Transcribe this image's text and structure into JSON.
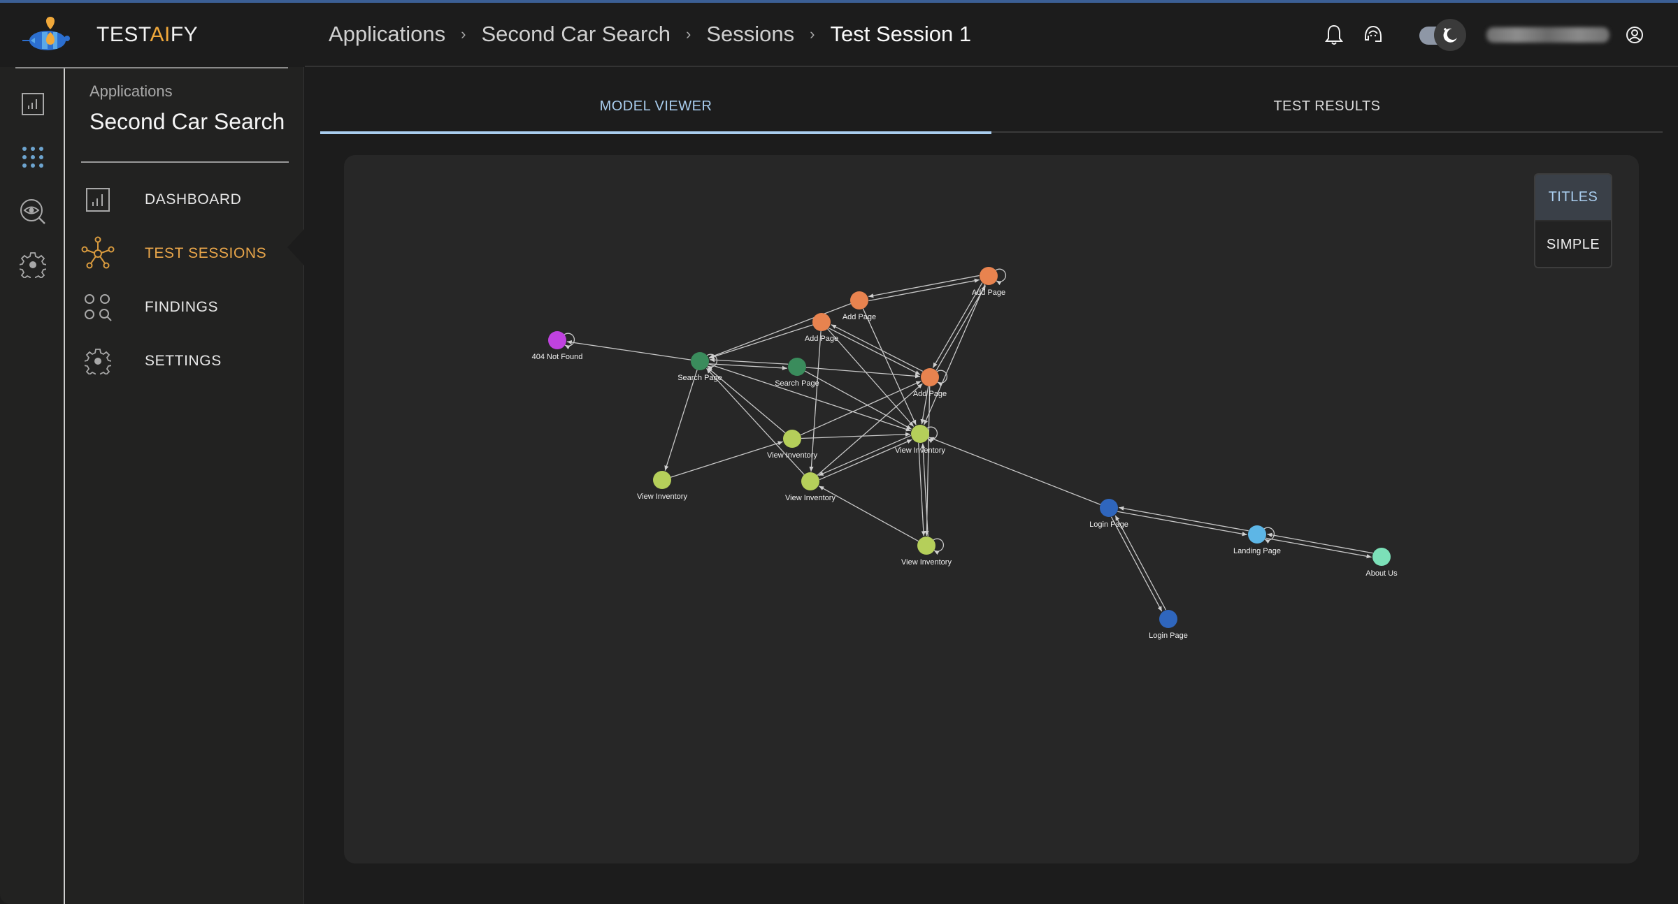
{
  "brand": {
    "name_prefix": "TEST",
    "name_accent": "AI",
    "name_suffix": "FY",
    "accent_color": "#f0a83a"
  },
  "breadcrumb": [
    {
      "label": "Applications"
    },
    {
      "label": "Second Car Search"
    },
    {
      "label": "Sessions"
    },
    {
      "label": "Test Session 1"
    }
  ],
  "breadcrumb_separator": "›",
  "header": {
    "icons": [
      "bell-icon",
      "support-headset-icon",
      "theme-toggle-moon-icon",
      "user-profile-icon"
    ],
    "theme": "dark",
    "user_name_blurred": true
  },
  "rail": {
    "items": [
      "dashboard-icon",
      "apps-grid-icon",
      "insights-eye-icon",
      "settings-gear-icon"
    ],
    "active_index": 1
  },
  "sidebar": {
    "section_label": "Applications",
    "app_title": "Second Car Search",
    "items": [
      {
        "label": "DASHBOARD",
        "icon": "dashboard-icon",
        "active": false
      },
      {
        "label": "TEST SESSIONS",
        "icon": "network-nodes-icon",
        "active": true
      },
      {
        "label": "FINDINGS",
        "icon": "findings-icon",
        "active": false
      },
      {
        "label": "SETTINGS",
        "icon": "gear-icon",
        "active": false
      }
    ]
  },
  "tabs": [
    {
      "label": "MODEL VIEWER",
      "active": true
    },
    {
      "label": "TEST RESULTS",
      "active": false
    }
  ],
  "view_modes": [
    {
      "label": "TITLES",
      "active": true
    },
    {
      "label": "SIMPLE",
      "active": false
    }
  ],
  "colors": {
    "accent": "#a9cdee",
    "active_nav": "#e9a64a",
    "node_404": "#c042e0",
    "node_search": "#3a8c5c",
    "node_add": "#e8834f",
    "node_view": "#b5cf5a",
    "node_login": "#2f66bd",
    "node_landing": "#5db6e6",
    "node_about": "#7ce0b8"
  },
  "graph": {
    "nodes": [
      {
        "id": "n404",
        "label": "404 Not Found",
        "type": "node_404",
        "self_loop": true
      },
      {
        "id": "sp1",
        "label": "Search Page",
        "type": "node_search",
        "self_loop": true
      },
      {
        "id": "sp2",
        "label": "Search Page",
        "type": "node_search",
        "self_loop": false
      },
      {
        "id": "ap1",
        "label": "Add Page",
        "type": "node_add",
        "self_loop": false
      },
      {
        "id": "ap2",
        "label": "Add Page",
        "type": "node_add",
        "self_loop": false
      },
      {
        "id": "ap3",
        "label": "Add Page",
        "type": "node_add",
        "self_loop": true
      },
      {
        "id": "ap4",
        "label": "Add Page",
        "type": "node_add",
        "self_loop": true
      },
      {
        "id": "vi1",
        "label": "View Inventory",
        "type": "node_view",
        "self_loop": false
      },
      {
        "id": "vi2",
        "label": "View Inventory",
        "type": "node_view",
        "self_loop": true
      },
      {
        "id": "vi3",
        "label": "View Inventory",
        "type": "node_view",
        "self_loop": false
      },
      {
        "id": "vi4",
        "label": "View Inventory",
        "type": "node_view",
        "self_loop": false
      },
      {
        "id": "vi5",
        "label": "View Inventory",
        "type": "node_view",
        "self_loop": true
      },
      {
        "id": "lp1",
        "label": "Login Page",
        "type": "node_login",
        "self_loop": false
      },
      {
        "id": "lp2",
        "label": "Login Page",
        "type": "node_login",
        "self_loop": false
      },
      {
        "id": "land",
        "label": "Landing Page",
        "type": "node_landing",
        "self_loop": true
      },
      {
        "id": "about",
        "label": "About Us",
        "type": "node_about",
        "self_loop": false
      }
    ],
    "edges": [
      [
        "sp1",
        "n404"
      ],
      [
        "sp1",
        "sp2"
      ],
      [
        "sp2",
        "sp1"
      ],
      [
        "ap1",
        "sp1"
      ],
      [
        "ap2",
        "sp1"
      ],
      [
        "sp1",
        "vi3"
      ],
      [
        "vi1",
        "sp1"
      ],
      [
        "vi4",
        "sp1"
      ],
      [
        "sp1",
        "vi2"
      ],
      [
        "sp2",
        "ap4"
      ],
      [
        "sp2",
        "vi2"
      ],
      [
        "ap3",
        "ap2"
      ],
      [
        "ap2",
        "ap3"
      ],
      [
        "ap1",
        "ap4"
      ],
      [
        "ap4",
        "ap1"
      ],
      [
        "ap1",
        "vi2"
      ],
      [
        "ap2",
        "vi2"
      ],
      [
        "ap3",
        "ap4"
      ],
      [
        "ap4",
        "ap3"
      ],
      [
        "ap3",
        "vi2"
      ],
      [
        "vi1",
        "ap4"
      ],
      [
        "vi4",
        "ap4"
      ],
      [
        "ap4",
        "vi2"
      ],
      [
        "ap4",
        "vi5"
      ],
      [
        "vi3",
        "vi1"
      ],
      [
        "vi1",
        "vi2"
      ],
      [
        "vi2",
        "vi4"
      ],
      [
        "vi4",
        "vi2"
      ],
      [
        "ap1",
        "vi4"
      ],
      [
        "vi2",
        "vi5"
      ],
      [
        "vi5",
        "vi2"
      ],
      [
        "vi5",
        "vi4"
      ],
      [
        "lp1",
        "vi2"
      ],
      [
        "lp1",
        "land"
      ],
      [
        "land",
        "lp1"
      ],
      [
        "lp1",
        "lp2"
      ],
      [
        "lp2",
        "lp1"
      ],
      [
        "land",
        "about"
      ],
      [
        "about",
        "land"
      ]
    ]
  }
}
